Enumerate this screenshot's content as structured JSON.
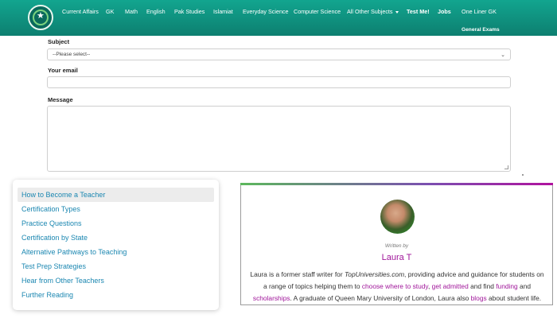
{
  "nav": {
    "items": [
      {
        "label": "Current Affairs"
      },
      {
        "label": "GK"
      },
      {
        "label": "Math"
      },
      {
        "label": "English"
      },
      {
        "label": "Pak Studies"
      },
      {
        "label": "Islamiat"
      },
      {
        "label": "Everyday Science"
      },
      {
        "label": "Computer Science"
      },
      {
        "label": "All Other Subjects"
      },
      {
        "label": "Test Me!"
      },
      {
        "label": "Jobs"
      },
      {
        "label": "One Liner GK"
      },
      {
        "label": "General Exams"
      }
    ]
  },
  "form": {
    "subject_label": "Subject",
    "subject_value": "--Please select--",
    "email_label": "Your email",
    "message_label": "Message"
  },
  "toc": {
    "items": [
      {
        "label": "How to Become a Teacher",
        "active": true
      },
      {
        "label": "Certification Types"
      },
      {
        "label": "Practice Questions"
      },
      {
        "label": "Certification by State"
      },
      {
        "label": "Alternative Pathways to Teaching"
      },
      {
        "label": "Test Prep Strategies"
      },
      {
        "label": "Hear from Other Teachers"
      },
      {
        "label": "Further Reading"
      }
    ]
  },
  "author": {
    "written_by": "Written by",
    "name": "Laura T",
    "bio": {
      "t1": "Laura is a former staff writer for ",
      "site": "TopUniversities.com",
      "t2": ", providing advice and guidance for students on a range of topics helping them to ",
      "link1": "choose where to study",
      "t3": ", ",
      "link2": "get admitted",
      "t4": " and find ",
      "link3": "funding",
      "t5": " and ",
      "link4": "scholarships",
      "t6": ". A graduate of Queen Mary University of London, Laura also ",
      "link5": "blogs",
      "t7": " about student life."
    }
  },
  "colors": {
    "header": "#0f8f7d",
    "link_blue": "#1b87b1",
    "accent_purple": "#a0169a"
  }
}
